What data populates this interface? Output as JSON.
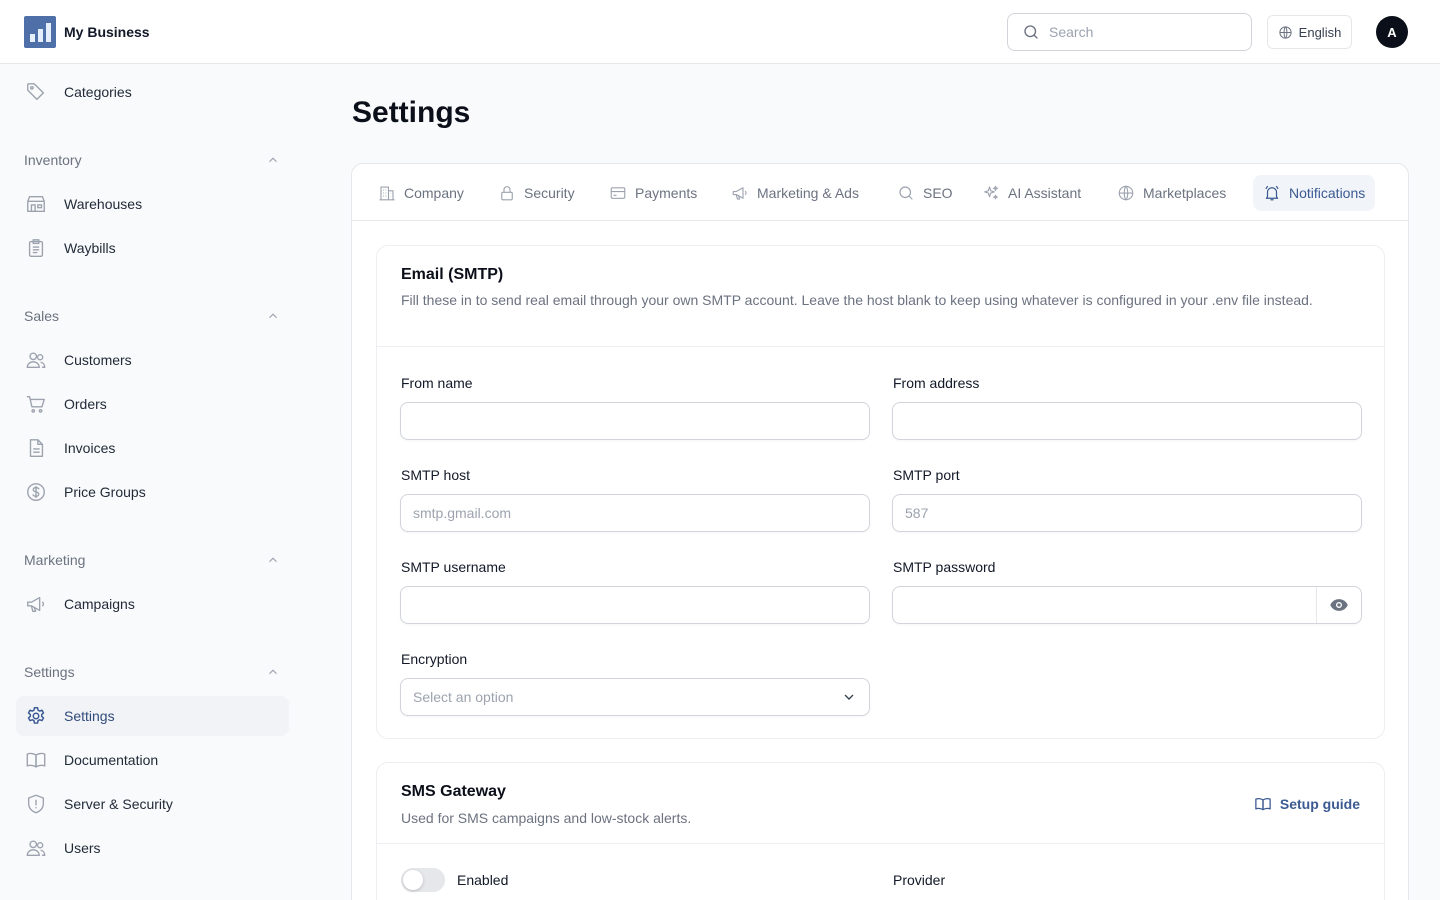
{
  "app": {
    "name": "My Business"
  },
  "header": {
    "search_placeholder": "Search",
    "language": "English",
    "avatar_initial": "A"
  },
  "sidebar": {
    "categories": "Categories",
    "groups": {
      "inventory": {
        "label": "Inventory",
        "items": [
          "Warehouses",
          "Waybills"
        ]
      },
      "sales": {
        "label": "Sales",
        "items": [
          "Customers",
          "Orders",
          "Invoices",
          "Price Groups"
        ]
      },
      "marketing": {
        "label": "Marketing",
        "items": [
          "Campaigns"
        ]
      },
      "settings": {
        "label": "Settings",
        "items": [
          "Settings",
          "Documentation",
          "Server & Security",
          "Users"
        ]
      }
    },
    "active_item": "Settings"
  },
  "page": {
    "title": "Settings"
  },
  "tabs": [
    "Company",
    "Security",
    "Payments",
    "Marketing & Ads",
    "SEO",
    "AI Assistant",
    "Marketplaces",
    "Notifications"
  ],
  "active_tab": "Notifications",
  "email": {
    "title": "Email (SMTP)",
    "description": "Fill these in to send real email through your own SMTP account. Leave the host blank to keep using whatever is configured in your .env file instead.",
    "fields": {
      "from_name": {
        "label": "From name",
        "value": "",
        "placeholder": ""
      },
      "from_address": {
        "label": "From address",
        "value": "",
        "placeholder": ""
      },
      "smtp_host": {
        "label": "SMTP host",
        "value": "",
        "placeholder": "smtp.gmail.com"
      },
      "smtp_port": {
        "label": "SMTP port",
        "value": "",
        "placeholder": "587"
      },
      "smtp_username": {
        "label": "SMTP username",
        "value": "",
        "placeholder": ""
      },
      "smtp_password": {
        "label": "SMTP password",
        "value": "",
        "placeholder": ""
      },
      "encryption": {
        "label": "Encryption",
        "placeholder": "Select an option"
      }
    }
  },
  "sms": {
    "title": "SMS Gateway",
    "description": "Used for SMS campaigns and low-stock alerts.",
    "setup_guide": "Setup guide",
    "enabled_label": "Enabled",
    "enabled": false,
    "provider_label": "Provider"
  }
}
